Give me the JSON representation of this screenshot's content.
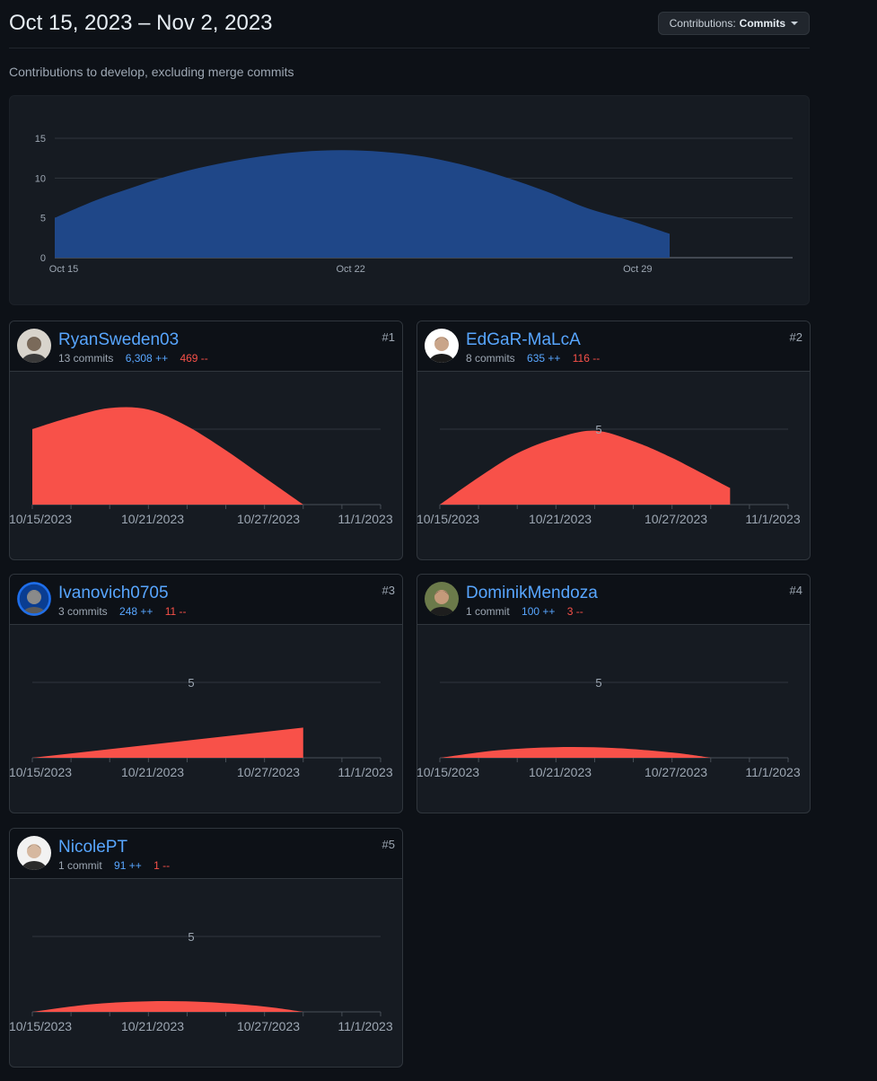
{
  "header": {
    "range_title": "Oct 15, 2023 – Nov 2, 2023",
    "dropdown_prefix": "Contributions:",
    "dropdown_value": "Commits"
  },
  "subtitle": "Contributions to develop, excluding merge commits",
  "colors": {
    "main_fill": "#1f4788",
    "contributor_fill": "#f85149",
    "link": "#58a6ff"
  },
  "chart_data": [
    {
      "type": "area",
      "series": [
        {
          "x": [
            "2023-10-15",
            "2023-10-16",
            "2023-10-17",
            "2023-10-18",
            "2023-10-19",
            "2023-10-20",
            "2023-10-21",
            "2023-10-22",
            "2023-10-23",
            "2023-10-24",
            "2023-10-25",
            "2023-10-26",
            "2023-10-27",
            "2023-10-28",
            "2023-10-29",
            "2023-10-30"
          ],
          "y": [
            5,
            7.2,
            9,
            10.6,
            11.8,
            12.7,
            13.3,
            13.5,
            13.3,
            12.7,
            11.6,
            10.1,
            8.3,
            6.2,
            4.7,
            3
          ]
        }
      ],
      "yticks": [
        0,
        5,
        10,
        15
      ],
      "xticks": [
        "Oct 15",
        "Oct 22",
        "Oct 29"
      ],
      "ylim": [
        0,
        15
      ],
      "xlim": [
        "2023-10-15",
        "2023-11-02"
      ],
      "grid": true
    }
  ],
  "contributors": [
    {
      "rank": "#1",
      "name": "RyanSweden03",
      "commits": "13 commits",
      "additions": "6,308 ++",
      "deletions": "469 --",
      "avatar_icon": "photo-avatar-icon",
      "chart_data": {
        "type": "area",
        "x": [
          "2023-10-15",
          "2023-10-17",
          "2023-10-19",
          "2023-10-21",
          "2023-10-23",
          "2023-10-25",
          "2023-10-27",
          "2023-10-29"
        ],
        "y": [
          5,
          5.8,
          6.4,
          6.3,
          5.2,
          3.6,
          1.8,
          0
        ],
        "ylim": [
          0,
          5
        ],
        "ytick_label": "",
        "xticks": [
          "10/15/2023",
          "10/21/2023",
          "10/27/2023",
          "11/1/2023"
        ]
      }
    },
    {
      "rank": "#2",
      "name": "EdGaR-MaLcA",
      "commits": "8 commits",
      "additions": "635 ++",
      "deletions": "116 --",
      "avatar_icon": "photo-avatar-icon",
      "chart_data": {
        "type": "area",
        "x": [
          "2023-10-15",
          "2023-10-17",
          "2023-10-19",
          "2023-10-21",
          "2023-10-23",
          "2023-10-25",
          "2023-10-27",
          "2023-10-30"
        ],
        "y": [
          0,
          1.8,
          3.4,
          4.4,
          4.9,
          4.2,
          3.1,
          1.1
        ],
        "ylim": [
          0,
          5
        ],
        "ytick_label": "5",
        "xticks": [
          "10/15/2023",
          "10/21/2023",
          "10/27/2023",
          "11/1/2023"
        ]
      }
    },
    {
      "rank": "#3",
      "name": "Ivanovich0705",
      "commits": "3 commits",
      "additions": "248 ++",
      "deletions": "11 --",
      "avatar_icon": "photo-avatar-icon",
      "chart_data": {
        "type": "area",
        "x": [
          "2023-10-15",
          "2023-10-29"
        ],
        "y": [
          0,
          2
        ],
        "ylim": [
          0,
          5
        ],
        "ytick_label": "5",
        "xticks": [
          "10/15/2023",
          "10/21/2023",
          "10/27/2023",
          "11/1/2023"
        ]
      }
    },
    {
      "rank": "#4",
      "name": "DominikMendoza",
      "commits": "1 commit",
      "additions": "100 ++",
      "deletions": "3 --",
      "avatar_icon": "photo-avatar-icon",
      "chart_data": {
        "type": "area",
        "x": [
          "2023-10-15",
          "2023-10-18",
          "2023-10-21",
          "2023-10-24",
          "2023-10-27",
          "2023-10-29"
        ],
        "y": [
          0,
          0.5,
          0.7,
          0.65,
          0.35,
          0
        ],
        "ylim": [
          0,
          5
        ],
        "ytick_label": "5",
        "xticks": [
          "10/15/2023",
          "10/21/2023",
          "10/27/2023",
          "11/1/2023"
        ]
      }
    },
    {
      "rank": "#5",
      "name": "NicolePT",
      "commits": "1 commit",
      "additions": "91 ++",
      "deletions": "1 --",
      "avatar_icon": "photo-avatar-icon",
      "chart_data": {
        "type": "area",
        "x": [
          "2023-10-15",
          "2023-10-18",
          "2023-10-21",
          "2023-10-24",
          "2023-10-27",
          "2023-10-29"
        ],
        "y": [
          0,
          0.5,
          0.7,
          0.65,
          0.35,
          0
        ],
        "ylim": [
          0,
          5
        ],
        "ytick_label": "5",
        "xticks": [
          "10/15/2023",
          "10/21/2023",
          "10/27/2023",
          "11/1/2023"
        ]
      }
    }
  ]
}
